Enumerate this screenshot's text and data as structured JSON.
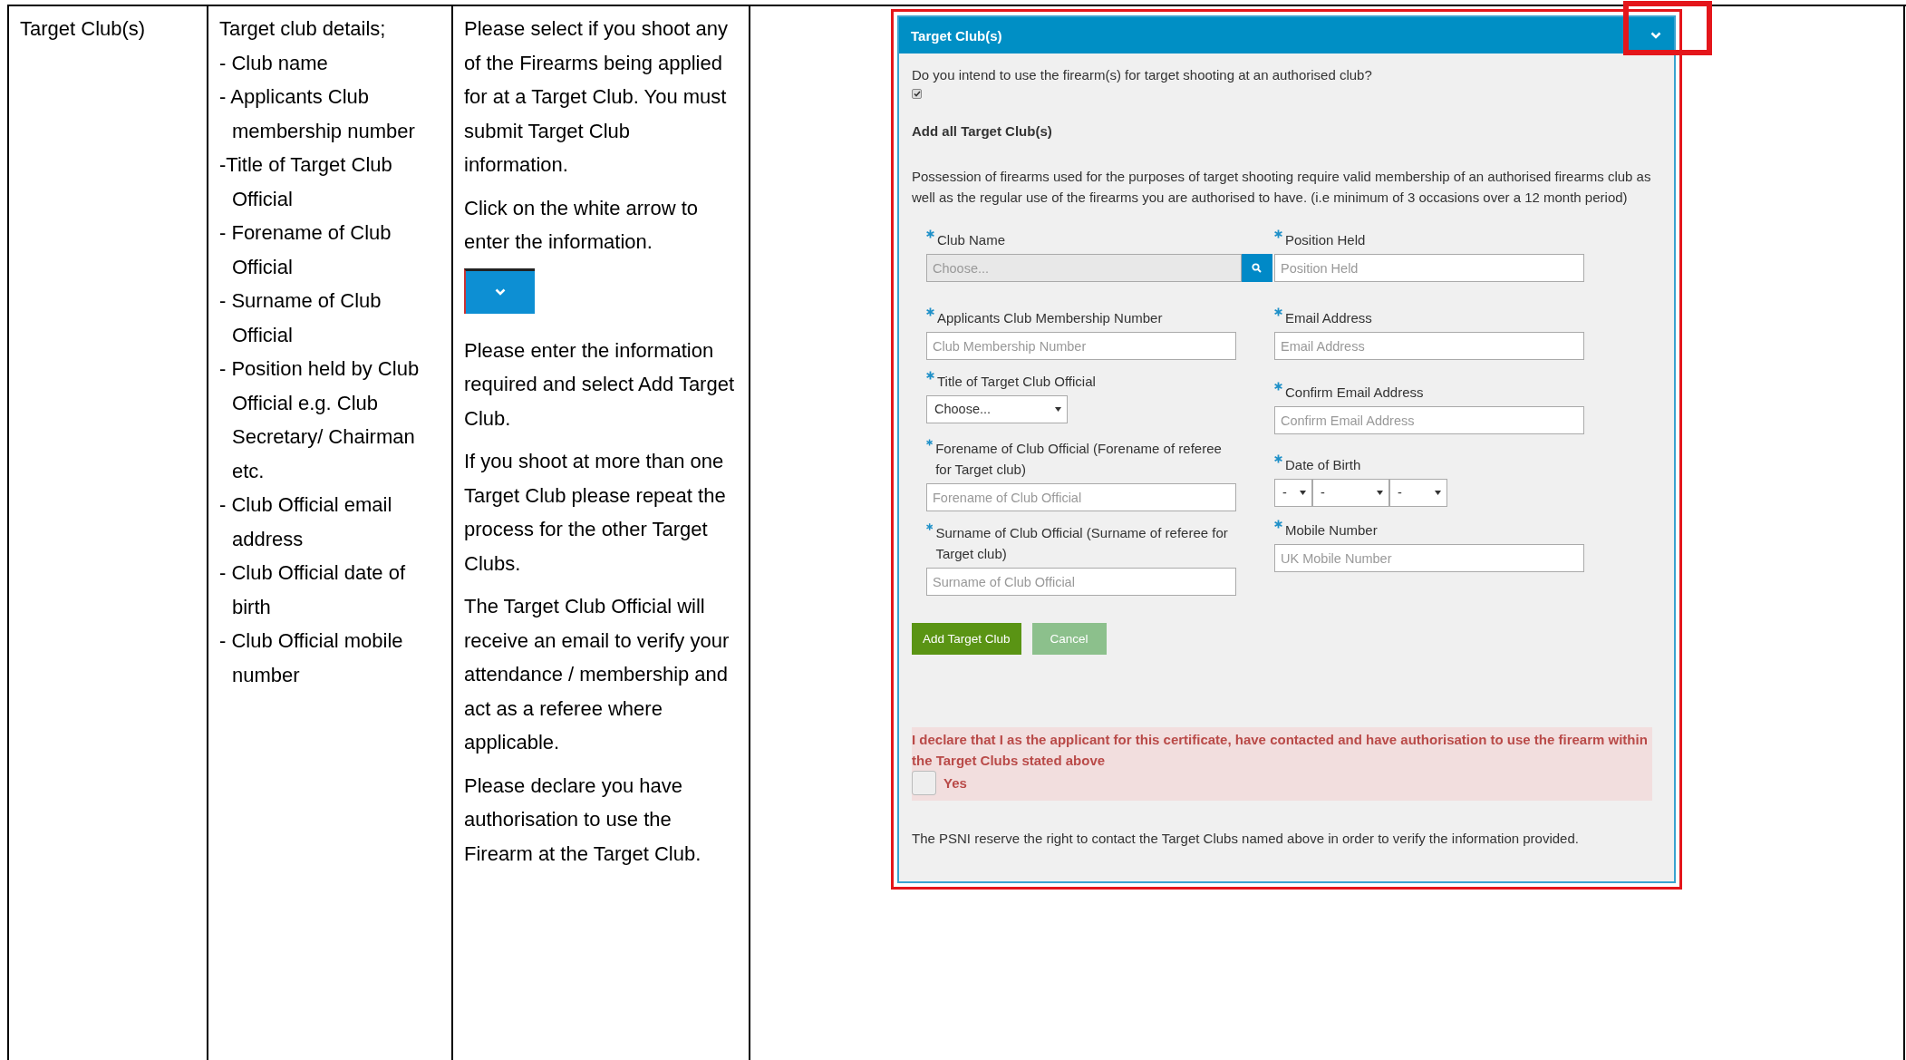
{
  "table": {
    "topic": "Target Club(s)",
    "details": [
      "Target club details;",
      "- Club name",
      "- Applicants Club membership number",
      "-Title of Target Club Official",
      "- Forename of Club Official",
      "- Surname of Club Official",
      "- Position held by Club Official e.g. Club Secretary/ Chairman etc.",
      "- Club Official email address",
      "- Club Official date of birth",
      "- Club Official mobile number"
    ],
    "guidance": [
      {
        "kind": "text",
        "text": "Please select if you shoot any of the Firearms being applied for at a Target Club. You must submit Target Club information."
      },
      {
        "kind": "text",
        "text": "Click on the white arrow to enter the information."
      },
      {
        "kind": "image"
      },
      {
        "kind": "text",
        "text": "Please enter the information required and select Add Target Club."
      },
      {
        "kind": "text",
        "text": "If you shoot at more than one Target Club please repeat the process for the other Target Clubs."
      },
      {
        "kind": "text",
        "text": "The Target Club Official will receive an email to verify your attendance / membership and act as a referee where applicable."
      },
      {
        "kind": "text",
        "text": "Please declare you have authorisation to use the Firearm at the Target Club."
      }
    ]
  },
  "panel": {
    "title": "Target Club(s)",
    "question": "Do you intend to use the firearm(s) for target shooting at an authorised club?",
    "question_checked": true,
    "subheading": "Add all Target Club(s)",
    "note": "Possession of firearms used for the purposes of target shooting require valid membership of an authorised firearms club as well as the regular use of the firearms you are authorised to have. (i.e minimum of 3 occasions over a 12 month period)",
    "left_fields": [
      {
        "kind": "lookup",
        "label": "Club Name",
        "placeholder": "Choose..."
      },
      {
        "kind": "text",
        "label": "Applicants Club Membership Number",
        "placeholder": "Club Membership Number"
      },
      {
        "kind": "select",
        "label": "Title of Target Club Official",
        "value": "Choose..."
      },
      {
        "kind": "text",
        "label": "Forename of Club Official (Forename of referee for Target club)",
        "placeholder": "Forename of Club Official"
      },
      {
        "kind": "text",
        "label": "Surname of Club Official (Surname of referee for Target club)",
        "placeholder": "Surname of Club Official"
      }
    ],
    "right_fields": [
      {
        "kind": "text",
        "label": "Position Held",
        "placeholder": "Position Held"
      },
      {
        "kind": "text",
        "label": "Email Address",
        "placeholder": "Email Address"
      },
      {
        "kind": "text",
        "label": "Confirm Email Address",
        "placeholder": "Confirm Email Address"
      },
      {
        "kind": "date",
        "label": "Date of Birth",
        "parts": [
          "-",
          "-",
          "-"
        ]
      },
      {
        "kind": "text",
        "label": "Mobile Number",
        "placeholder": "UK Mobile Number"
      }
    ],
    "buttons": [
      {
        "label": "Add Target Club",
        "disabled": false
      },
      {
        "label": "Cancel",
        "disabled": true
      }
    ],
    "declaration": "I declare that I as the applicant for this certificate, have contacted and have authorisation to use the firearm within the Target Clubs stated above",
    "declaration_option": {
      "label": "Yes",
      "checked": false
    },
    "footer": "The PSNI reserve the right to contact the Target Clubs named above in order to verify the information provided."
  }
}
